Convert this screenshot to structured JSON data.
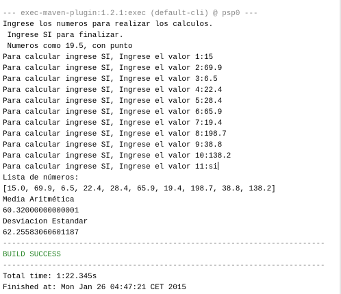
{
  "console": {
    "header": "--- exec-maven-plugin:1.2.1:exec (default-cli) @ psp0 ---",
    "intro": [
      "Ingrese los numeros para realizar los calculos.",
      " Ingrese SI para finalizar.",
      " Numeros como 19.5, con punto"
    ],
    "prompts": [
      "Para calcular ingrese SI, Ingrese el valor 1:15",
      "Para calcular ingrese SI, Ingrese el valor 2:69.9",
      "Para calcular ingrese SI, Ingrese el valor 3:6.5",
      "Para calcular ingrese SI, Ingrese el valor 4:22.4",
      "Para calcular ingrese SI, Ingrese el valor 5:28.4",
      "Para calcular ingrese SI, Ingrese el valor 6:65.9",
      "Para calcular ingrese SI, Ingrese el valor 7:19.4",
      "Para calcular ingrese SI, Ingrese el valor 8:198.7",
      "Para calcular ingrese SI, Ingrese el valor 9:38.8",
      "Para calcular ingrese SI, Ingrese el valor 10:138.2",
      "Para calcular ingrese SI, Ingrese el valor 11:si"
    ],
    "list_label": "Lista de números:",
    "list_values": "[15.0, 69.9, 6.5, 22.4, 28.4, 65.9, 19.4, 198.7, 38.8, 138.2]",
    "mean_label": "Media Aritmética",
    "mean_value": "60.32000000000001",
    "std_label": "Desviacion Estandar",
    "std_value": "62.25583060601187",
    "separator1": "------------------------------------------------------------------------",
    "build_status": "BUILD SUCCESS",
    "separator2": "------------------------------------------------------------------------",
    "total_time": "Total time: 1:22.345s",
    "finished_at": "Finished at: Mon Jan 26 04:47:21 CET 2015"
  },
  "colors": {
    "header": "#8a8a8a",
    "separator": "#8a8a8a",
    "build_status": "#2f8a2f",
    "text": "#000000"
  }
}
